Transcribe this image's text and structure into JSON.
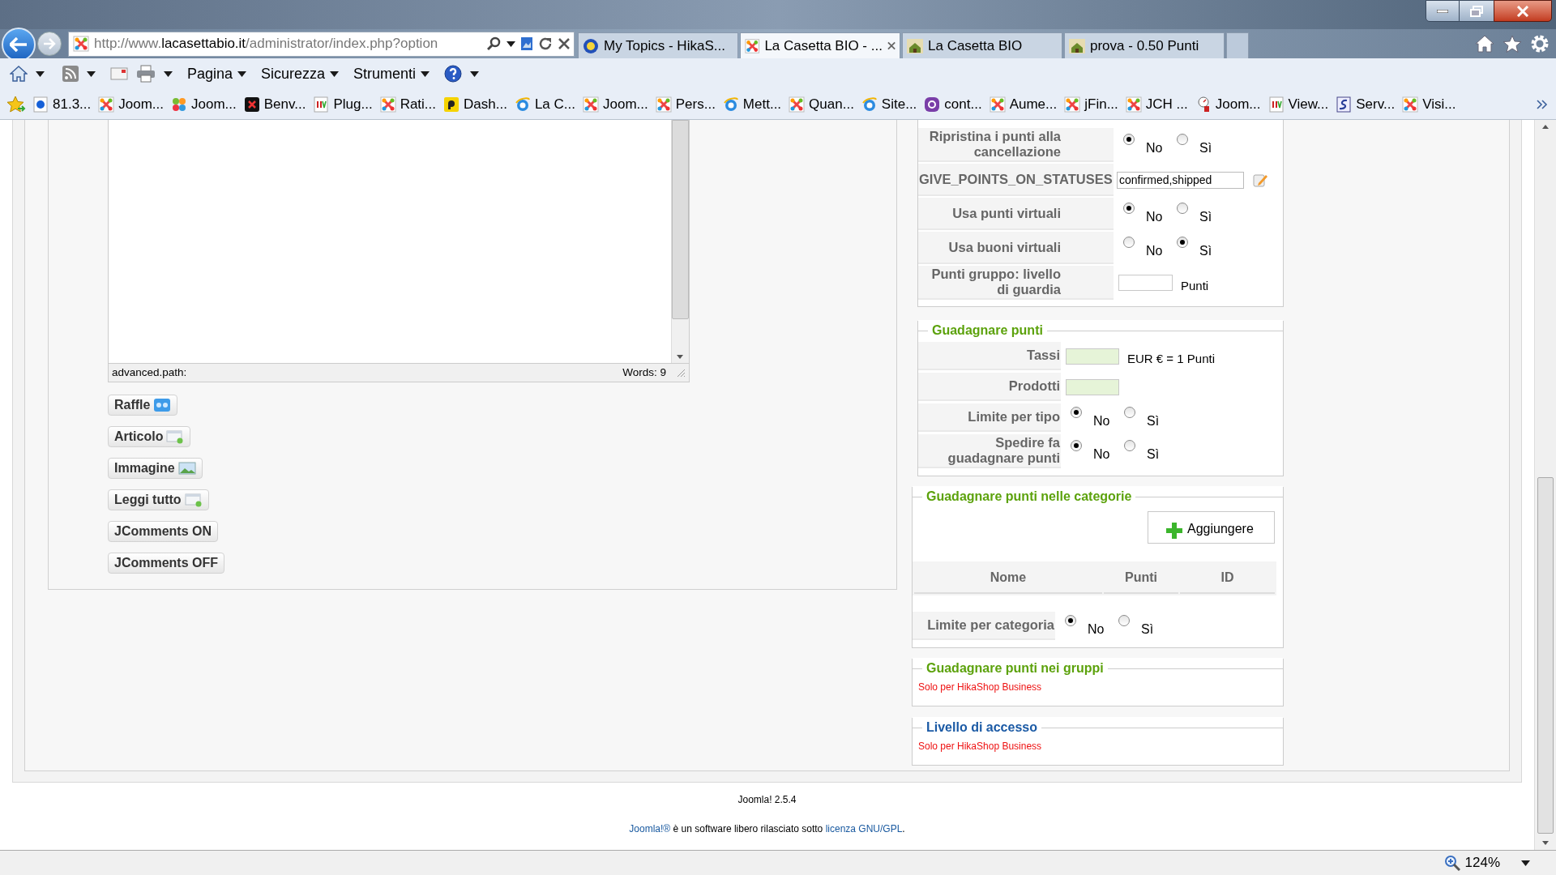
{
  "browser": {
    "address": {
      "prefix": "http://www.",
      "domain": "lacasettabio.it",
      "rest": "/administrator/index.php?option"
    },
    "tabs": [
      {
        "label": "My Topics - HikaS...",
        "selected": false,
        "kind": "hika"
      },
      {
        "label": "La Casetta BIO - ...",
        "selected": true,
        "kind": "joomla"
      },
      {
        "label": "La Casetta BIO",
        "selected": false,
        "kind": "casetta"
      },
      {
        "label": "prova - 0.50 Punti",
        "selected": false,
        "kind": "casetta"
      }
    ],
    "menus": [
      "Pagina",
      "Sicurezza",
      "Strumenti"
    ],
    "favorites": [
      {
        "label": "81.3...",
        "kind": "dot"
      },
      {
        "label": "Joom...",
        "kind": "joomla"
      },
      {
        "label": "Joom...",
        "kind": "flower"
      },
      {
        "label": "Benv...",
        "kind": "dark"
      },
      {
        "label": "Plug...",
        "kind": "jv"
      },
      {
        "label": "Rati...",
        "kind": "joomla"
      },
      {
        "label": "Dash...",
        "kind": "p"
      },
      {
        "label": "La C...",
        "kind": "ie"
      },
      {
        "label": "Joom...",
        "kind": "joomla"
      },
      {
        "label": "Pers...",
        "kind": "joomla"
      },
      {
        "label": "Mett...",
        "kind": "ie"
      },
      {
        "label": "Quan...",
        "kind": "joomla"
      },
      {
        "label": "Site...",
        "kind": "ie"
      },
      {
        "label": "cont...",
        "kind": "t"
      },
      {
        "label": "Aume...",
        "kind": "joomla"
      },
      {
        "label": "jFin...",
        "kind": "joomla"
      },
      {
        "label": "JCH ...",
        "kind": "joomla"
      },
      {
        "label": "Joom...",
        "kind": "jp"
      },
      {
        "label": "View...",
        "kind": "jv"
      },
      {
        "label": "Serv...",
        "kind": "sf"
      },
      {
        "label": "Visi...",
        "kind": "joomla"
      }
    ]
  },
  "editor": {
    "path": "advanced.path:",
    "words": "Words: 9"
  },
  "buttons": [
    {
      "label": "Raffle",
      "kind": "tickets"
    },
    {
      "label": "Articolo",
      "kind": "page"
    },
    {
      "label": "Immagine",
      "kind": "image"
    },
    {
      "label": "Leggi tutto",
      "kind": "page"
    },
    {
      "label": "JComments ON",
      "kind": "plain"
    },
    {
      "label": "JComments OFF",
      "kind": "plain"
    }
  ],
  "sections": [
    {
      "rows": [
        {
          "kind": "radio",
          "label": "Ripristina i punti alla cancellazione",
          "options": [
            {
              "label": "No",
              "selected": true
            },
            {
              "label": "Sì",
              "selected": false
            }
          ]
        },
        {
          "kind": "text",
          "label": "GIVE_POINTS_ON_STATUSES",
          "value": "confirmed,shipped"
        },
        {
          "kind": "radio",
          "label": "Usa punti virtuali",
          "options": [
            {
              "label": "No",
              "selected": true
            },
            {
              "label": "Sì",
              "selected": false
            }
          ]
        },
        {
          "kind": "radio",
          "label": "Usa buoni virtuali",
          "options": [
            {
              "label": "No",
              "selected": false
            },
            {
              "label": "Sì",
              "selected": true
            }
          ]
        },
        {
          "kind": "input",
          "label": "Punti gruppo: livello di guardia",
          "suffix": "Punti"
        }
      ]
    },
    {
      "title": "Guadagnare punti",
      "color": "#5ca20c",
      "rows": [
        {
          "kind": "amount",
          "label": "Tassi",
          "suffix": "EUR € = 1 Punti"
        },
        {
          "kind": "amount",
          "label": "Prodotti"
        },
        {
          "kind": "radio",
          "label": "Limite per tipo",
          "options": [
            {
              "label": "No",
              "selected": true
            },
            {
              "label": "Sì",
              "selected": false
            }
          ]
        },
        {
          "kind": "radio",
          "label": "Spedire fa guadagnare punti",
          "options": [
            {
              "label": "No",
              "selected": true
            },
            {
              "label": "Sì",
              "selected": false
            }
          ]
        }
      ]
    },
    {
      "title": "Guadagnare punti nelle categorie",
      "color": "#5ca20c",
      "rows": [
        {
          "kind": "button",
          "label": "Aggiungere"
        },
        {
          "kind": "table",
          "columns": [
            "Nome",
            "Punti",
            "ID"
          ]
        },
        {
          "kind": "radio",
          "label": "Limite per categoria",
          "options": [
            {
              "label": "No",
              "selected": true
            },
            {
              "label": "Sì",
              "selected": false
            }
          ]
        }
      ]
    },
    {
      "title": "Guadagnare punti nei gruppi",
      "color": "#5ca20c",
      "rows": [
        {
          "kind": "note",
          "text": "Solo per HikaShop Business"
        }
      ]
    },
    {
      "title": "Livello di accesso",
      "color": "#1b5aa5",
      "rows": [
        {
          "kind": "note",
          "text": "Solo per HikaShop Business"
        }
      ]
    }
  ],
  "footer": {
    "version": "Joomla! 2.5.4",
    "license": [
      {
        "text": "Joomla!®",
        "link": true
      },
      {
        "text": " è un software libero rilasciato sotto ",
        "link": false
      },
      {
        "text": "licenza GNU/GPL",
        "link": true
      },
      {
        "text": ".",
        "link": false
      }
    ]
  },
  "status_bar": {
    "zoom": "124%"
  }
}
